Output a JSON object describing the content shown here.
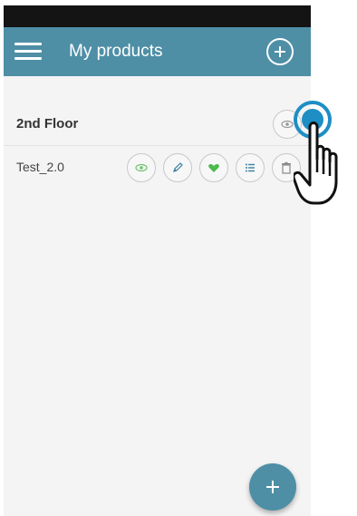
{
  "app_bar": {
    "title": "My products",
    "menu_icon": "hamburger-menu-icon",
    "add_icon": "plus-circle-icon",
    "background_color": "#4e8fa6"
  },
  "groups": [
    {
      "label": "2nd Floor",
      "actions": [
        "eye-icon"
      ]
    }
  ],
  "products": [
    {
      "label": "Test_2.0",
      "actions": [
        "eye-icon",
        "pencil-icon",
        "heart-icon",
        "list-icon",
        "trash-icon"
      ],
      "action_colors": {
        "eye-icon": "#6dc36d",
        "pencil-icon": "#3a7fa0",
        "heart-icon": "#4cba4c",
        "list-icon": "#3a7fa0",
        "trash-icon": "#888888"
      }
    }
  ],
  "fab": {
    "icon": "plus-icon",
    "color": "#4e8fa6"
  },
  "overlay": {
    "tap_indicator_color": "#1e8ec5",
    "cursor_icon": "hand-pointer-icon"
  }
}
